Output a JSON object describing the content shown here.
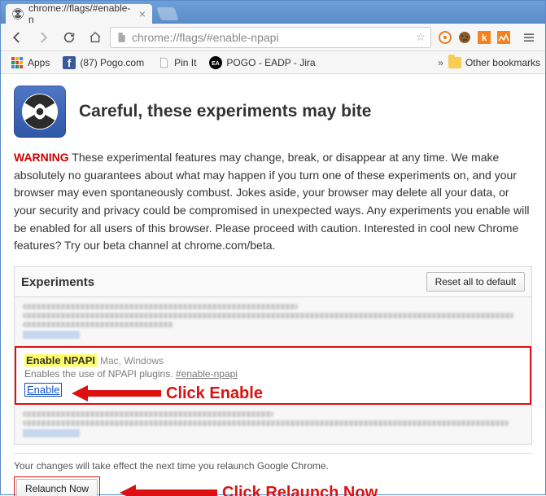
{
  "tab": {
    "title": "chrome://flags/#enable-n",
    "favicon": "hazard-icon"
  },
  "toolbar": {
    "url": "chrome://flags/#enable-npapi"
  },
  "bookmarks": {
    "apps": "Apps",
    "items": [
      {
        "label": "(87) Pogo.com",
        "icon": "facebook"
      },
      {
        "label": "Pin It",
        "icon": "page"
      },
      {
        "label": "POGO - EADP - Jira",
        "icon": "ea"
      }
    ],
    "other": "Other bookmarks"
  },
  "page": {
    "title": "Careful, these experiments may bite",
    "warning_label": "WARNING",
    "warning_text": " These experimental features may change, break, or disappear at any time. We make absolutely no guarantees about what may happen if you turn one of these experiments on, and your browser may even spontaneously combust. Jokes aside, your browser may delete all your data, or your security and privacy could be compromised in unexpected ways. Any experiments you enable will be enabled for all users of this browser. Please proceed with caution. Interested in cool new Chrome features? Try our beta channel at chrome.com/beta."
  },
  "experiments": {
    "heading": "Experiments",
    "reset_label": "Reset all to default",
    "npapi": {
      "name": "Enable NPAPI",
      "platforms": "Mac, Windows",
      "desc": "Enables the use of NPAPI plugins. ",
      "anchor": "#enable-npapi",
      "action": "Enable"
    }
  },
  "footer": {
    "msg": "Your changes will take effect the next time you relaunch Google Chrome.",
    "relaunch": "Relaunch Now"
  },
  "annotations": {
    "click_enable": "Click Enable",
    "click_relaunch": "Click Relaunch Now"
  }
}
